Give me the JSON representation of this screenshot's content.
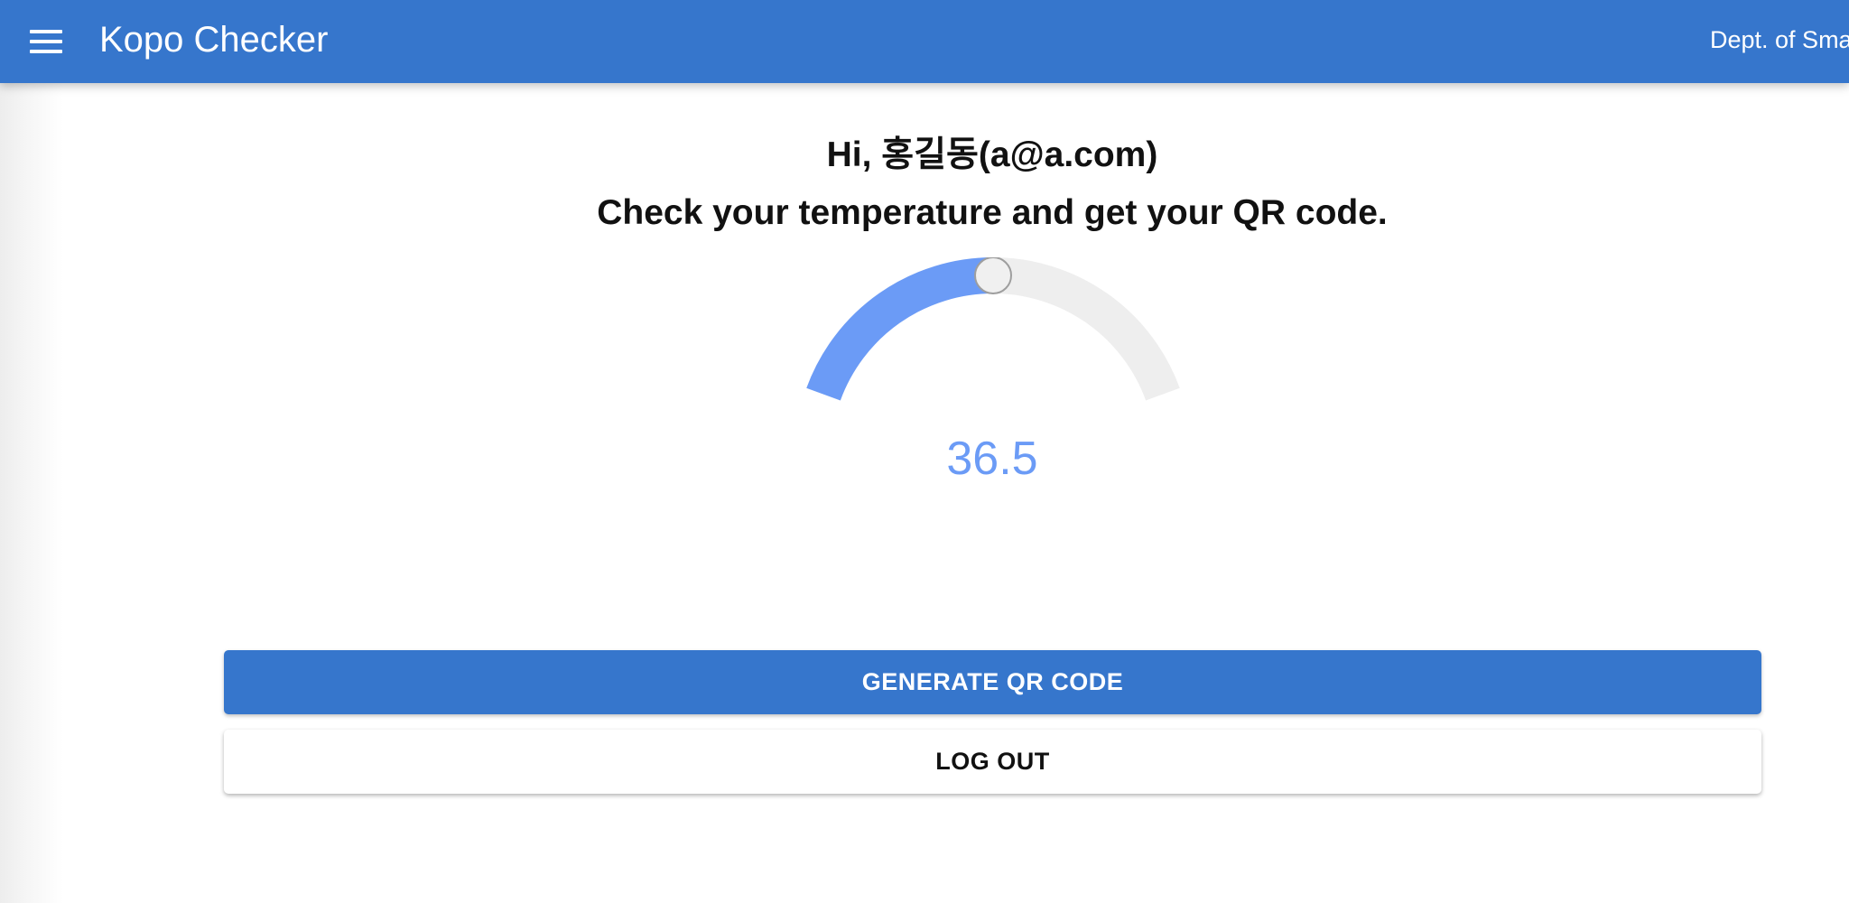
{
  "appbar": {
    "title": "Kopo Checker",
    "dept": "Dept. of Sma",
    "color": "#3676cc"
  },
  "main": {
    "greeting": "Hi, 홍길동(a@a.com)",
    "instruction": "Check your temperature and get your QR code."
  },
  "temperature": {
    "value": "36.5",
    "fill_fraction": 0.5,
    "fill_color": "#6b9bf6",
    "track_color": "#eeeeee"
  },
  "actions": {
    "generate_label": "GENERATE QR CODE",
    "logout_label": "LOG OUT"
  }
}
